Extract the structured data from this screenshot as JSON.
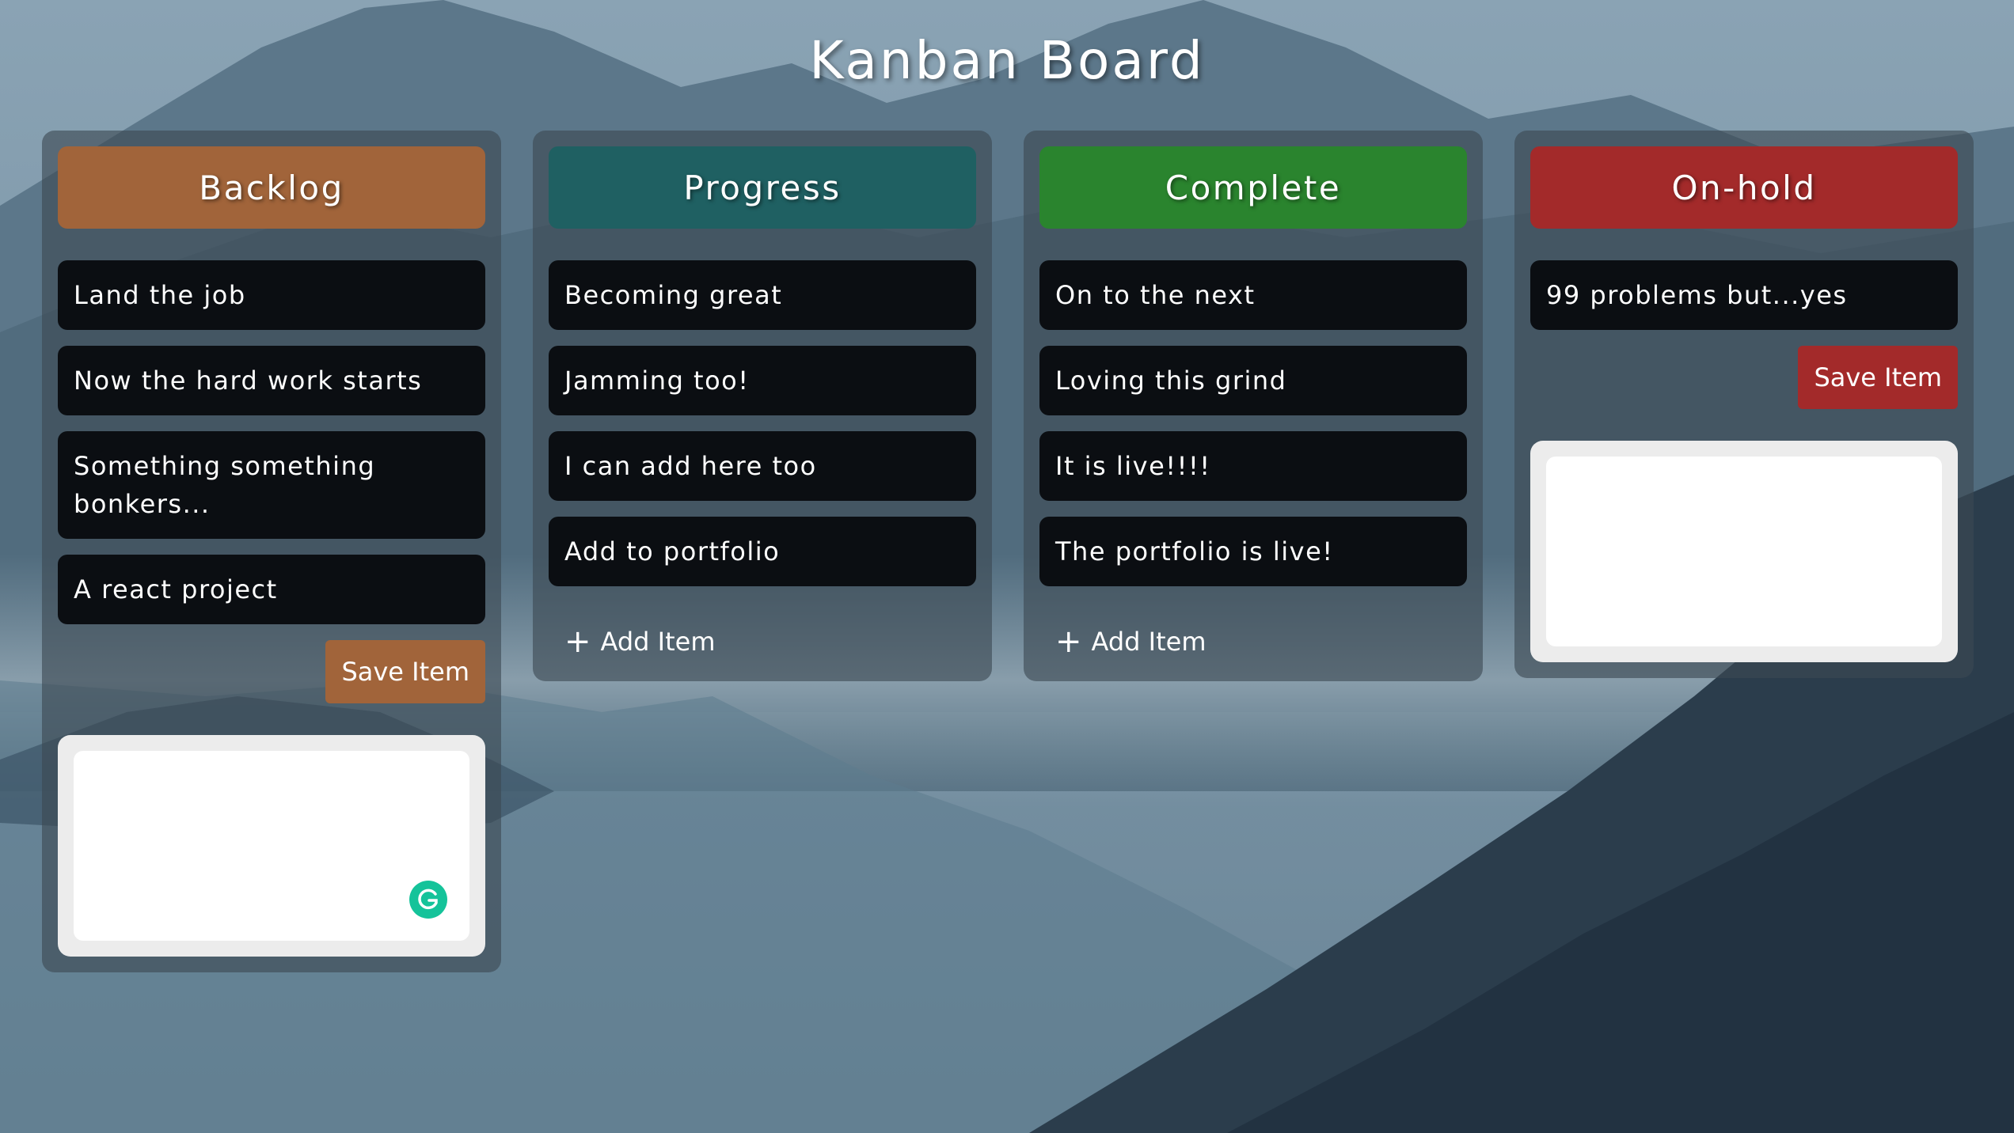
{
  "page": {
    "title": "Kanban Board"
  },
  "columns": [
    {
      "key": "backlog",
      "title": "Backlog",
      "color": "#a1643a",
      "items": [
        "Land the job",
        "Now the hard work starts",
        "Something something bonkers...",
        "A react project"
      ],
      "save_label": "Save Item"
    },
    {
      "key": "progress",
      "title": "Progress",
      "color": "#1f6062",
      "items": [
        "Becoming great",
        "Jamming too!",
        "I can add here too",
        "Add to portfolio"
      ],
      "add_label": "Add Item",
      "add_icon": "+"
    },
    {
      "key": "complete",
      "title": "Complete",
      "color": "#2a842e",
      "items": [
        "On to the next",
        "Loving this grind",
        "It is live!!!!",
        "The portfolio is live!"
      ],
      "add_label": "Add Item",
      "add_icon": "+"
    },
    {
      "key": "onhold",
      "title": "On-hold",
      "color": "#a32a2a",
      "items": [
        "99 problems but...yes"
      ],
      "save_label": "Save Item"
    }
  ],
  "icons": {
    "grammarly": "grammarly-icon",
    "grammarly_color": "#15c39a"
  }
}
